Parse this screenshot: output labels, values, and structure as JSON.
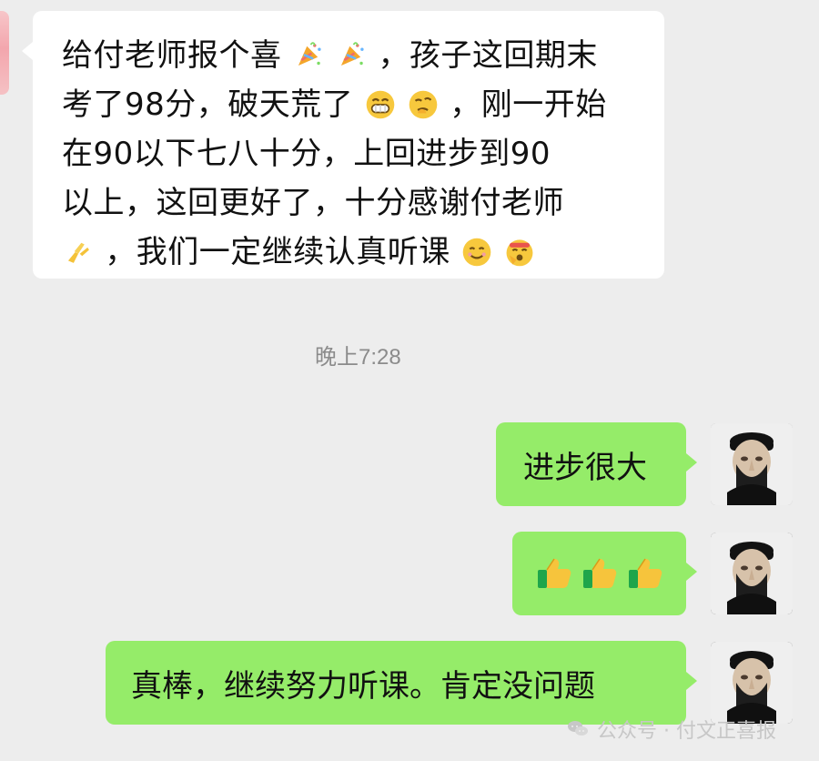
{
  "chat": {
    "incoming": {
      "lines": [
        {
          "a": "给付老师报个喜",
          "b": "，孩子这回期末"
        },
        {
          "a": "考了98分，破天荒了",
          "b": "，刚一开始"
        },
        {
          "a": "在90以下七八十分，上回进步到90"
        },
        {
          "a": "以上，这回更好了，十分感谢付老师"
        },
        {
          "a": "，我们一定继续认真听课"
        }
      ]
    },
    "timestamp": "晚上7:28",
    "outgoing": [
      {
        "text": "进步很大"
      },
      {
        "thumbs_count": 3
      },
      {
        "text": "真棒，继续努力听课。肯定没问题"
      }
    ]
  },
  "watermark": {
    "text": "公众号 · 付文正喜报"
  },
  "icons": {
    "party_popper": "party-popper-icon",
    "grinning": "grinning-face-icon",
    "thinking": "thinking-face-icon",
    "clapping": "folded-hands-icon",
    "smile": "smiling-face-icon",
    "headband": "headband-face-icon",
    "thumbs_up": "thumbs-up-icon"
  },
  "colors": {
    "background": "#ededed",
    "incoming_bubble": "#ffffff",
    "outgoing_bubble": "#95ec69",
    "timestamp": "#8b8b8b"
  }
}
